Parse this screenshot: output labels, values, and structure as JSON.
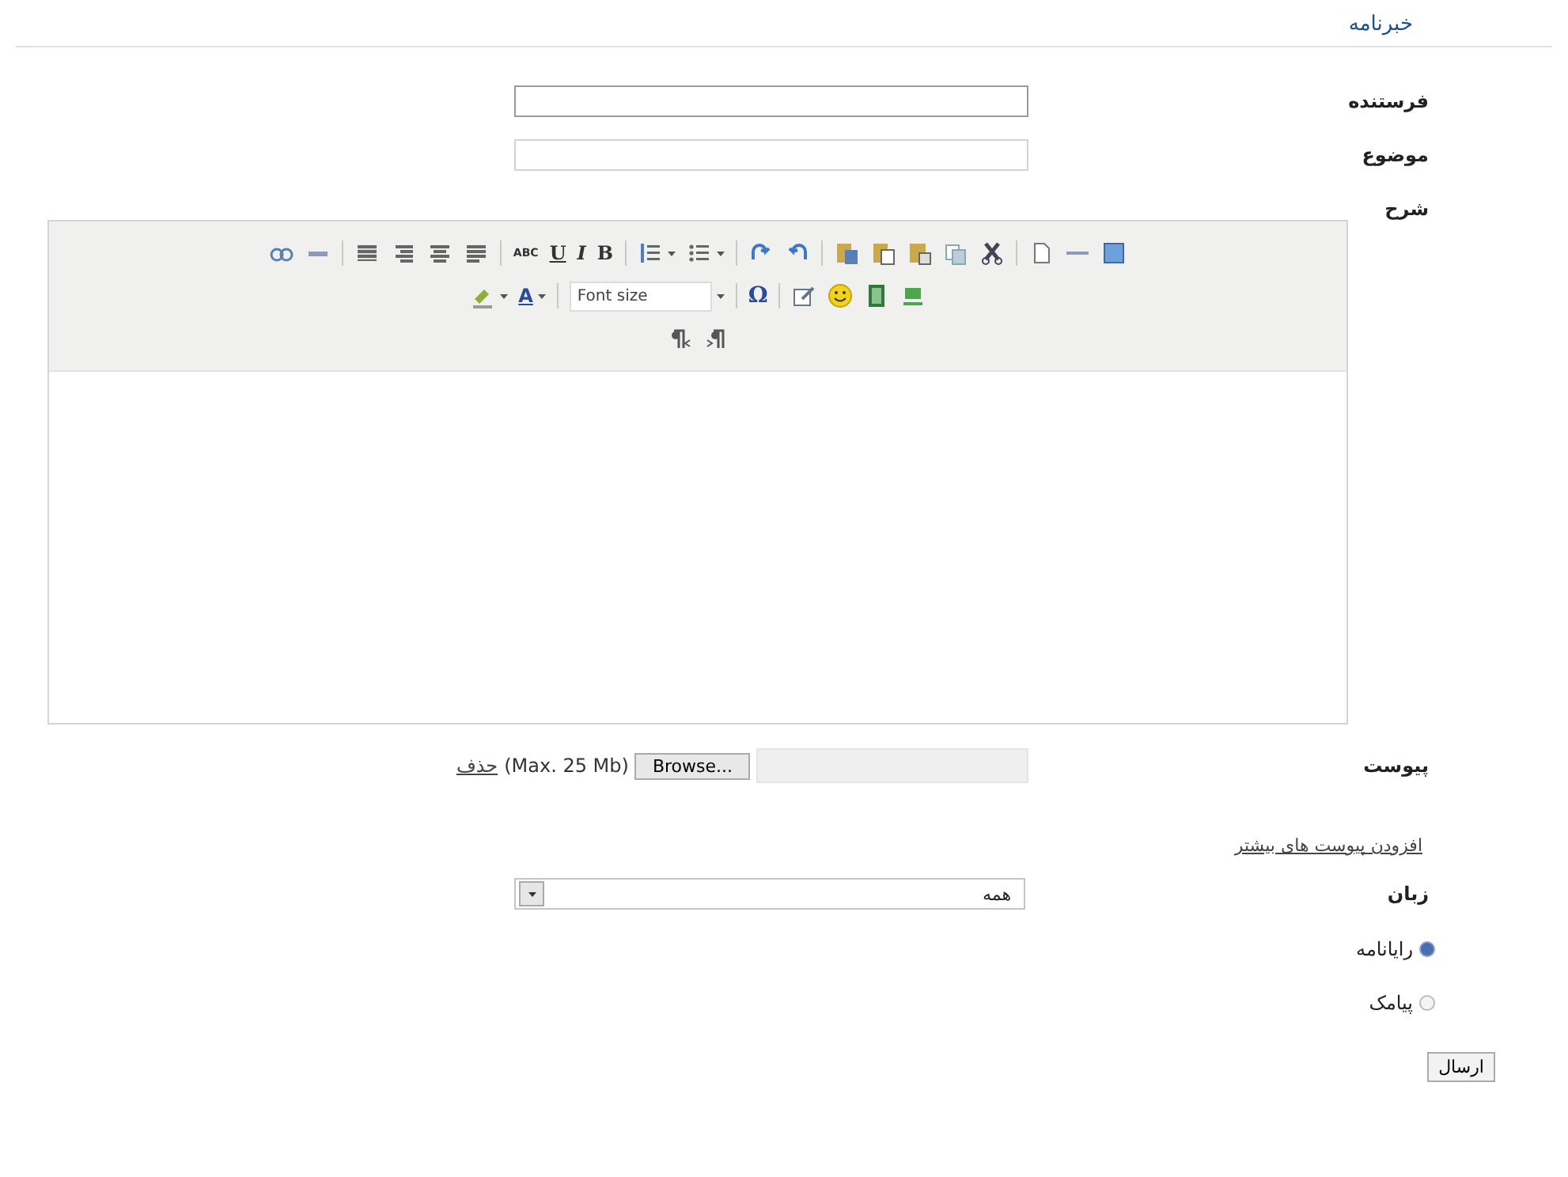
{
  "title": "خبرنامه",
  "sender": {
    "label": "فرستنده"
  },
  "subject": {
    "label": "موضوع"
  },
  "description": {
    "label": "شرح"
  },
  "editor": {
    "toolbar": {
      "strike": "ABC",
      "underline": "U",
      "italic": "I",
      "bold": "B",
      "font_color": "A",
      "font_size_placeholder": "Font size",
      "special_char": "Ω"
    }
  },
  "attachment": {
    "label": "پیوست",
    "delete_link": "حذف",
    "limit": "(Max. 25 Mb)",
    "browse_button": "Browse..."
  },
  "add_more_link": "افزودن پیوست های بیشتر",
  "language": {
    "label": "زبان",
    "value": "همه"
  },
  "channels": [
    {
      "label": "رایانامه",
      "selected": true
    },
    {
      "label": "پیامک",
      "selected": false
    }
  ],
  "submit_button": "ارسال"
}
